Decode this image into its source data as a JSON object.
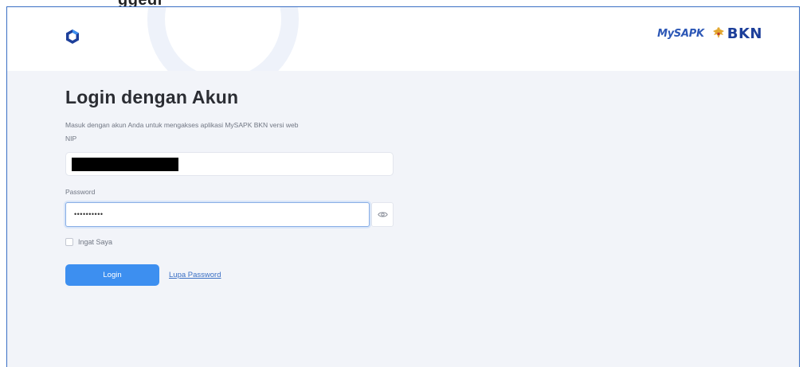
{
  "top_fragment": "ggedi",
  "header": {
    "partner_logos": {
      "mysapk": "MySAPK",
      "bkn": "BKN"
    }
  },
  "login": {
    "title": "Login dengan Akun",
    "subtitle": "Masuk dengan akun Anda untuk mengakses aplikasi MySAPK BKN versi web",
    "nip_label": "NIP",
    "password_label": "Password",
    "password_value": "••••••••••",
    "remember_label": "Ingat Saya",
    "login_button": "Login",
    "forgot_link": "Lupa Password"
  },
  "icons": {
    "app_logo": "app-logo-icon",
    "eye": "eye-icon",
    "bkn_emblem": "garuda-emblem-icon"
  },
  "colors": {
    "primary": "#3d8ff0",
    "link": "#3a6fc4",
    "page_bg": "#f2f4f9",
    "bkn_blue": "#1d3f9a"
  }
}
